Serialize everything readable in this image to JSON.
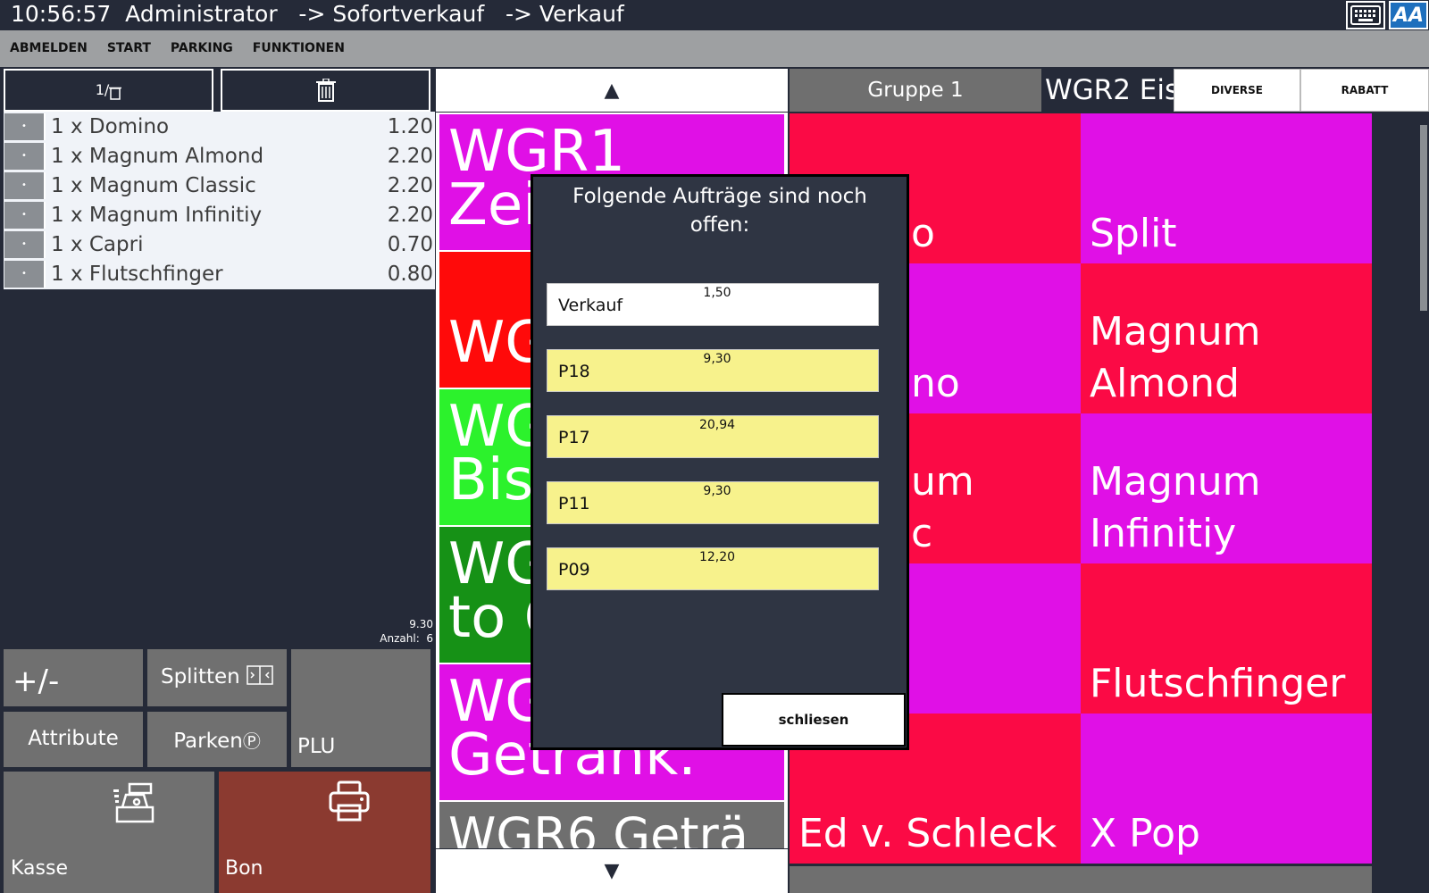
{
  "titlebar": {
    "text": "10:56:57  Administrator   -> Sofortverkauf   -> Verkauf",
    "keyboard_icon": "keyboard-icon",
    "font_icon_label": "AA"
  },
  "menu": [
    "ABMELDEN",
    "START",
    "PARKING",
    "FUNKTIONEN"
  ],
  "order_tools": {
    "split_label": "1/",
    "delete_icon": "trash-icon"
  },
  "order": {
    "items": [
      {
        "name": "1 x Domino",
        "price": "1.20"
      },
      {
        "name": "1 x Magnum Almond",
        "price": "2.20"
      },
      {
        "name": "1 x Magnum Classic",
        "price": "2.20"
      },
      {
        "name": "1 x Magnum Infinitiy",
        "price": "2.20"
      },
      {
        "name": "1 x Capri",
        "price": "0.70"
      },
      {
        "name": "1 x Flutschfinger",
        "price": "0.80"
      }
    ],
    "total": "9.30",
    "count_label": "Anzahl:  6"
  },
  "pad": {
    "plusminus": "+/-",
    "splitten": "Splitten",
    "attribute": "Attribute",
    "parken": "Parken",
    "parken_symbol": "Ⓟ",
    "plu": "PLU",
    "kasse": "Kasse",
    "bon": "Bon"
  },
  "groups": {
    "up_arrow": "▲",
    "down_arrow": "▼",
    "items": [
      {
        "line1": "WGR1",
        "line2": "Zeit",
        "color": "#e010e6"
      },
      {
        "line1": "",
        "line2": "WG",
        "color": "#ff0a0a"
      },
      {
        "line1": "WG",
        "line2": "Bist",
        "color": "#2cf22c"
      },
      {
        "line1": "WG",
        "line2": "to C",
        "color": "#169116"
      },
      {
        "line1": "WG",
        "line2": "Getränk.",
        "color": "#e010e6"
      },
      {
        "line1": "WGR6 Geträ",
        "line2": "",
        "color": "#6f6f6f"
      }
    ]
  },
  "tabs": {
    "gruppe": "Gruppe 1",
    "wgr2": "WGR2 Eis",
    "diverse": "DIVERSE",
    "rabatt": "RABATT"
  },
  "products": [
    {
      "line1": "",
      "line2": "o",
      "color": "#fb0a45"
    },
    {
      "line1": "",
      "line2": "Split",
      "color": "#e010e6"
    },
    {
      "line1": "",
      "line2": "no",
      "color": "#e010e6"
    },
    {
      "line1": "Magnum",
      "line2": "Almond",
      "color": "#fb0a45"
    },
    {
      "line1": "um",
      "line2": "c",
      "color": "#fb0a45"
    },
    {
      "line1": "Magnum",
      "line2": "Infinitiy",
      "color": "#e010e6"
    },
    {
      "line1": "",
      "line2": "",
      "color": "#e010e6"
    },
    {
      "line1": "",
      "line2": "Flutschfinger",
      "color": "#fb0a45"
    },
    {
      "line1": "",
      "line2": "Ed v. Schleck",
      "color": "#fb0a45"
    },
    {
      "line1": "",
      "line2": "X Pop",
      "color": "#e010e6"
    }
  ],
  "dialog": {
    "title": "Folgende Aufträge sind noch offen:",
    "rows": [
      {
        "name": "Verkauf",
        "amount": "1,50",
        "color": "#ffffff"
      },
      {
        "name": "P18",
        "amount": "9,30",
        "color": "#f7f28c"
      },
      {
        "name": "P17",
        "amount": "20,94",
        "color": "#f7f28c"
      },
      {
        "name": "P11",
        "amount": "9,30",
        "color": "#f7f28c"
      },
      {
        "name": "P09",
        "amount": "12,20",
        "color": "#f7f28c"
      }
    ],
    "close_label": "schliesen"
  }
}
